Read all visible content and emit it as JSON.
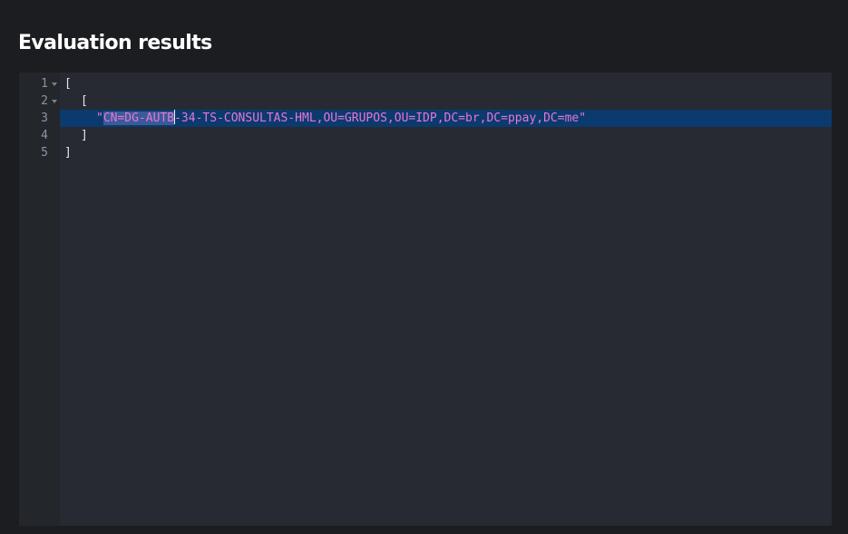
{
  "panel": {
    "title": "Evaluation results"
  },
  "editor": {
    "line_numbers": [
      "1",
      "2",
      "3",
      "4",
      "5"
    ],
    "lines": [
      {
        "text": "["
      },
      {
        "text": "["
      },
      {
        "quote_open": "\"",
        "selected": "CN=DG-AUTB",
        "rest": "-34-TS-CONSULTAS-HML,OU=GRUPOS,OU=IDP,DC=br,DC=ppay,DC=me",
        "quote_close": "\""
      },
      {
        "text": "]"
      },
      {
        "text": "]"
      }
    ],
    "colors": {
      "background": "#272a33",
      "gutter": "#23272b",
      "active_line": "#0b3a6e",
      "selection": "#3a5a9a",
      "string": "#e876d4"
    }
  }
}
